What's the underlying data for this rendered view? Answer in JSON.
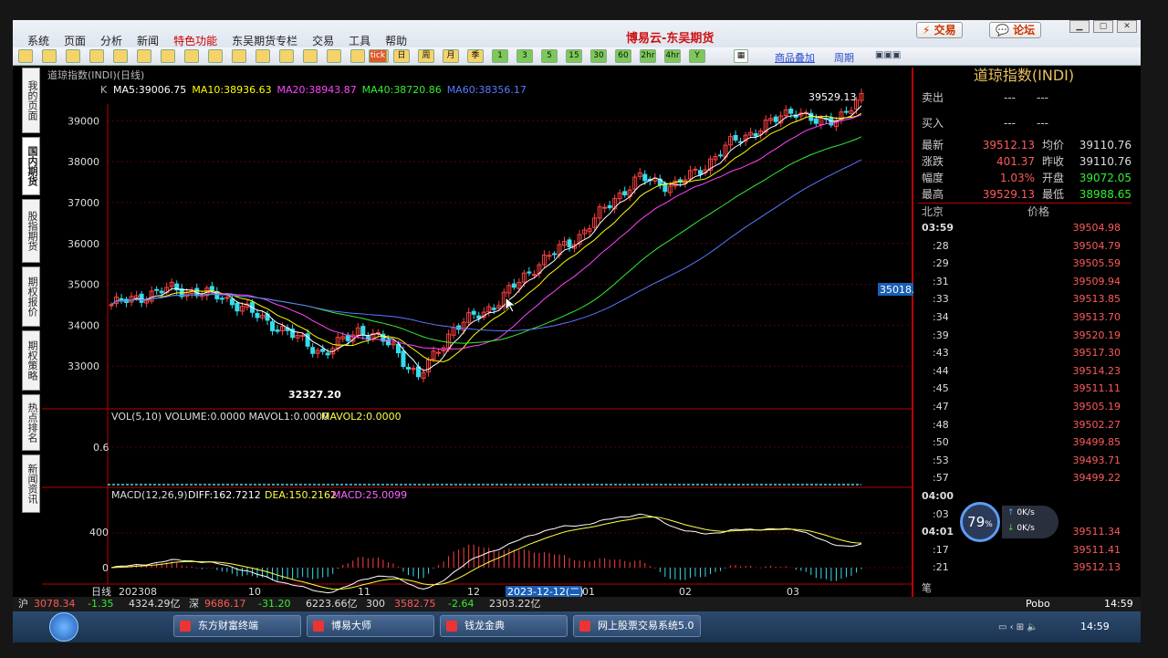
{
  "menu": [
    "系统",
    "页面",
    "分析",
    "新闻",
    "特色功能",
    "东吴期货专栏",
    "交易",
    "工具",
    "帮助"
  ],
  "app_title": "博易云-东吴期货",
  "title_buttons": {
    "trade": "交易",
    "forum": "论坛"
  },
  "toolbar_labels": [
    "tick",
    "日",
    "周",
    "月",
    "季",
    "1",
    "3",
    "5",
    "15",
    "30",
    "60",
    "2hr",
    "4hr",
    "Y"
  ],
  "chart_header": {
    "name": "道琼指数(INDI)(日线)",
    "overlay_link": "商品叠加",
    "period_link": "周期"
  },
  "left_tabs": [
    "我的页面",
    "国内期货",
    "股指期货",
    "期权报价",
    "期权策略",
    "热点排名",
    "新闻资讯"
  ],
  "ma_labels": [
    {
      "text": "MA5:39006.75",
      "color": "#ffffff"
    },
    {
      "text": "MA10:38936.63",
      "color": "#ffff00"
    },
    {
      "text": "MA20:38943.87",
      "color": "#ff44ff"
    },
    {
      "text": "MA40:38720.86",
      "color": "#33ee33"
    },
    {
      "text": "MA60:38356.17",
      "color": "#5a78ff"
    }
  ],
  "k_label": "K",
  "price_axis": [
    39000,
    38000,
    37000,
    36000,
    35000,
    34000,
    33000
  ],
  "annotations": {
    "high": "39529.13",
    "low": "32327.20",
    "cursor_price": "35018.23"
  },
  "vol_panel": {
    "title": "VOL(5,10) VOLUME:0.0000 MAVOL1:0.0000",
    "mavol2": "MAVOL2:0.0000",
    "axis_label": "0.6"
  },
  "macd_panel": {
    "title": "MACD(12,26,9)",
    "diff": "DIFF:162.7212",
    "dea": "DEA:150.2162",
    "macd": "MACD:25.0099",
    "axis": [
      "400",
      "0"
    ]
  },
  "x_axis": {
    "period": "日线",
    "labels": [
      "202308",
      "10",
      "11",
      "12",
      "01",
      "02",
      "03"
    ],
    "cursor_date": "2023-12-12(二)"
  },
  "quote": {
    "title": "道琼指数(INDI)",
    "sell_label": "卖出",
    "buy_label": "买入",
    "dash": "---",
    "rows": [
      {
        "k1": "最新",
        "v1": "39512.13",
        "c1": "#ff5a5a",
        "k2": "均价",
        "v2": "39110.76",
        "c2": "#dddddd"
      },
      {
        "k1": "涨跌",
        "v1": "401.37",
        "c1": "#ff5a5a",
        "k2": "昨收",
        "v2": "39110.76",
        "c2": "#dddddd"
      },
      {
        "k1": "幅度",
        "v1": "1.03%",
        "c1": "#ff5a5a",
        "k2": "开盘",
        "v2": "39072.05",
        "c2": "#33ee33"
      },
      {
        "k1": "最高",
        "v1": "39529.13",
        "c1": "#ff5a5a",
        "k2": "最低",
        "v2": "38988.65",
        "c2": "#33ee33"
      }
    ],
    "tick_header": {
      "region": "北京",
      "price": "价格"
    },
    "ticks": [
      {
        "t": "03:59",
        "p": "39504.98"
      },
      {
        "t": ":28",
        "p": "39504.79"
      },
      {
        "t": ":29",
        "p": "39505.59"
      },
      {
        "t": ":31",
        "p": "39509.94"
      },
      {
        "t": ":33",
        "p": "39513.85"
      },
      {
        "t": ":34",
        "p": "39513.70"
      },
      {
        "t": ":39",
        "p": "39520.19"
      },
      {
        "t": ":43",
        "p": "39517.30"
      },
      {
        "t": ":44",
        "p": "39514.23"
      },
      {
        "t": ":45",
        "p": "39511.11"
      },
      {
        "t": ":47",
        "p": "39505.19"
      },
      {
        "t": ":48",
        "p": "39502.27"
      },
      {
        "t": ":50",
        "p": "39499.85"
      },
      {
        "t": ":53",
        "p": "39493.71"
      },
      {
        "t": ":57",
        "p": "39499.22"
      },
      {
        "t": "04:00",
        "p": ""
      },
      {
        "t": ":03",
        "p": ""
      },
      {
        "t": "04:01",
        "p": "39511.34"
      },
      {
        "t": ":17",
        "p": "39511.41"
      },
      {
        "t": ":21",
        "p": "39512.13"
      }
    ],
    "gauge": {
      "percent": "79",
      "unit": "%",
      "up": "0K/s",
      "down": "0K/s"
    },
    "bottom_label": "笔"
  },
  "status": {
    "items": [
      "沪",
      "3078.34",
      "-1.35",
      "4324.29亿",
      "深",
      "9686.17",
      "-31.20",
      "6223.66亿",
      "300",
      "3582.75",
      "-2.64",
      "2303.22亿"
    ],
    "brand": "Pobo",
    "time": "14:59"
  },
  "taskbar": {
    "tasks": [
      "东方财富终端",
      "博易大师",
      "钱龙金典",
      "网上股票交易系统5.0"
    ],
    "clock": "14:59"
  }
}
